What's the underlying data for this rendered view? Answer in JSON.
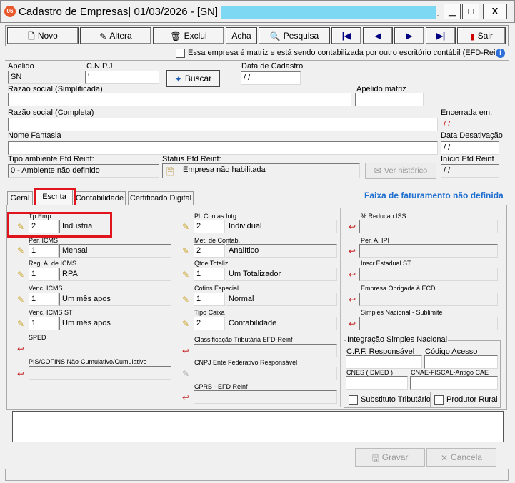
{
  "window": {
    "icon_text": "06",
    "title": "Cadastro de Empresas|  01/03/2026 - [SN] -",
    "title_suffix": ".",
    "highlight_color": "#7dd8f4",
    "minimize": "▁",
    "maximize": "□",
    "close": "X"
  },
  "toolbar": {
    "novo": "Novo",
    "altera": "Altera",
    "exclui": "Exclui",
    "acha": "Acha",
    "pesquisa": "Pesquisa",
    "first": "|◀",
    "prev": "◀",
    "next": "▶",
    "last": "▶|",
    "sair": "Sair"
  },
  "header": {
    "matriz_check_label": "Essa empresa é matriz e está sendo contabilizada por outro escritório contábil (EFD-Reinf",
    "info_icon": "i"
  },
  "form": {
    "apelido_label": "Apelido",
    "apelido_value": "SN",
    "cnpj_label": "C.N.P.J",
    "cnpj_value": "'",
    "buscar": "Buscar",
    "data_cadastro_label": "Data de Cadastro",
    "data_cadastro_value": " / /",
    "razao_simpl_label": "Razao social (Simplificada)",
    "apelido_matriz_label": "Apelido matriz",
    "razao_completa_label": "Razão social (Completa)",
    "encerrada_label": "Encerrada em:",
    "encerrada_value": " / /",
    "nome_fantasia_label": "Nome Fantasia",
    "data_desativacao_label": "Data Desativação",
    "data_desativacao_value": " / /",
    "tipo_amb_label": "Tipo ambiente Efd Reinf:",
    "tipo_amb_value": "0 - Ambiente não definido",
    "status_label": "Status Efd Reinf:",
    "status_value": "Empresa não habilitada",
    "ver_historico": "Ver histórico",
    "inicio_label": "Início Efd Reinf",
    "inicio_value": " / /"
  },
  "tabs": {
    "geral": "Geral",
    "escrita": "Escrita",
    "contabilidade": "Contabilidade",
    "certificado": "Certificado Digital",
    "faixa": "Faixa de faturamento não definida"
  },
  "col1": {
    "tp_emp_label": "Tp Emp.",
    "tp_emp_code": "2",
    "tp_emp_desc": "Industria",
    "per_icms_label": "Per. ICMS",
    "per_icms_code": "1",
    "per_icms_desc": "Mensal",
    "reg_icms_label": "Reg.  A. de ICMS",
    "reg_icms_code": "1",
    "reg_icms_desc": "RPA",
    "venc_icms_label": "Venc. ICMS",
    "venc_icms_code": "1",
    "venc_icms_desc": "Um mês apos",
    "venc_st_label": "Venc. ICMS ST",
    "venc_st_code": "1",
    "venc_st_desc": "Um mês apos",
    "sped_label": "SPED",
    "pis_label": "PIS/COFINS Não-Cumulativo/Cumulativo"
  },
  "col2": {
    "pl_contas_label": "Pl. Contas Intg.",
    "pl_contas_code": "2",
    "pl_contas_desc": "Individual",
    "met_contab_label": "Met. de Contab.",
    "met_contab_code": "2",
    "met_contab_desc": "Analítico",
    "qtde_label": "Qtde Totaliz.",
    "qtde_code": "1",
    "qtde_desc": "Um Totalizador",
    "cofins_label": "Cofins Especial",
    "cofins_code": "1",
    "cofins_desc": "Normal",
    "tipo_caixa_label": "Tipo Caixa",
    "tipo_caixa_code": "2",
    "tipo_caixa_desc": "Contabilidade",
    "classif_label": "Classificação Tributária EFD-Reinf",
    "cnpj_ente_label": "CNPJ Ente Federativo Responsável",
    "cprb_label": "CPRB - EFD Reinf"
  },
  "col3": {
    "reducao_iss_label": "% Reducao ISS",
    "per_ipi_label": "Per. A.  IPI",
    "inscr_st_label": "Inscr.Estadual ST",
    "obrig_ecd_label": "Empresa Obrigada à ECD",
    "simples_sub_label": "Simples Nacional - Sublimite",
    "integracao_label": "Integração Simples Nacional",
    "cpf_resp_label": "C.P.F. Responsável",
    "cod_acesso_label": "Código Acesso",
    "cnes_label": "CNES ( DMED )",
    "cnae_label": "CNAE-FISCAL-Antigo CAE",
    "subst_label": "Substituto Tributário",
    "produtor_label": "Produtor Rural"
  },
  "footer": {
    "gravar": "Gravar",
    "cancela": "Cancela"
  },
  "icons": {
    "pencil_yellow": "✎",
    "arrow_red": "↩",
    "pencil_gray": "✎"
  },
  "colors": {
    "highlight_red": "#e0141c",
    "faixa_blue": "#1f6fd0",
    "encerrada_red": "#c00000"
  }
}
